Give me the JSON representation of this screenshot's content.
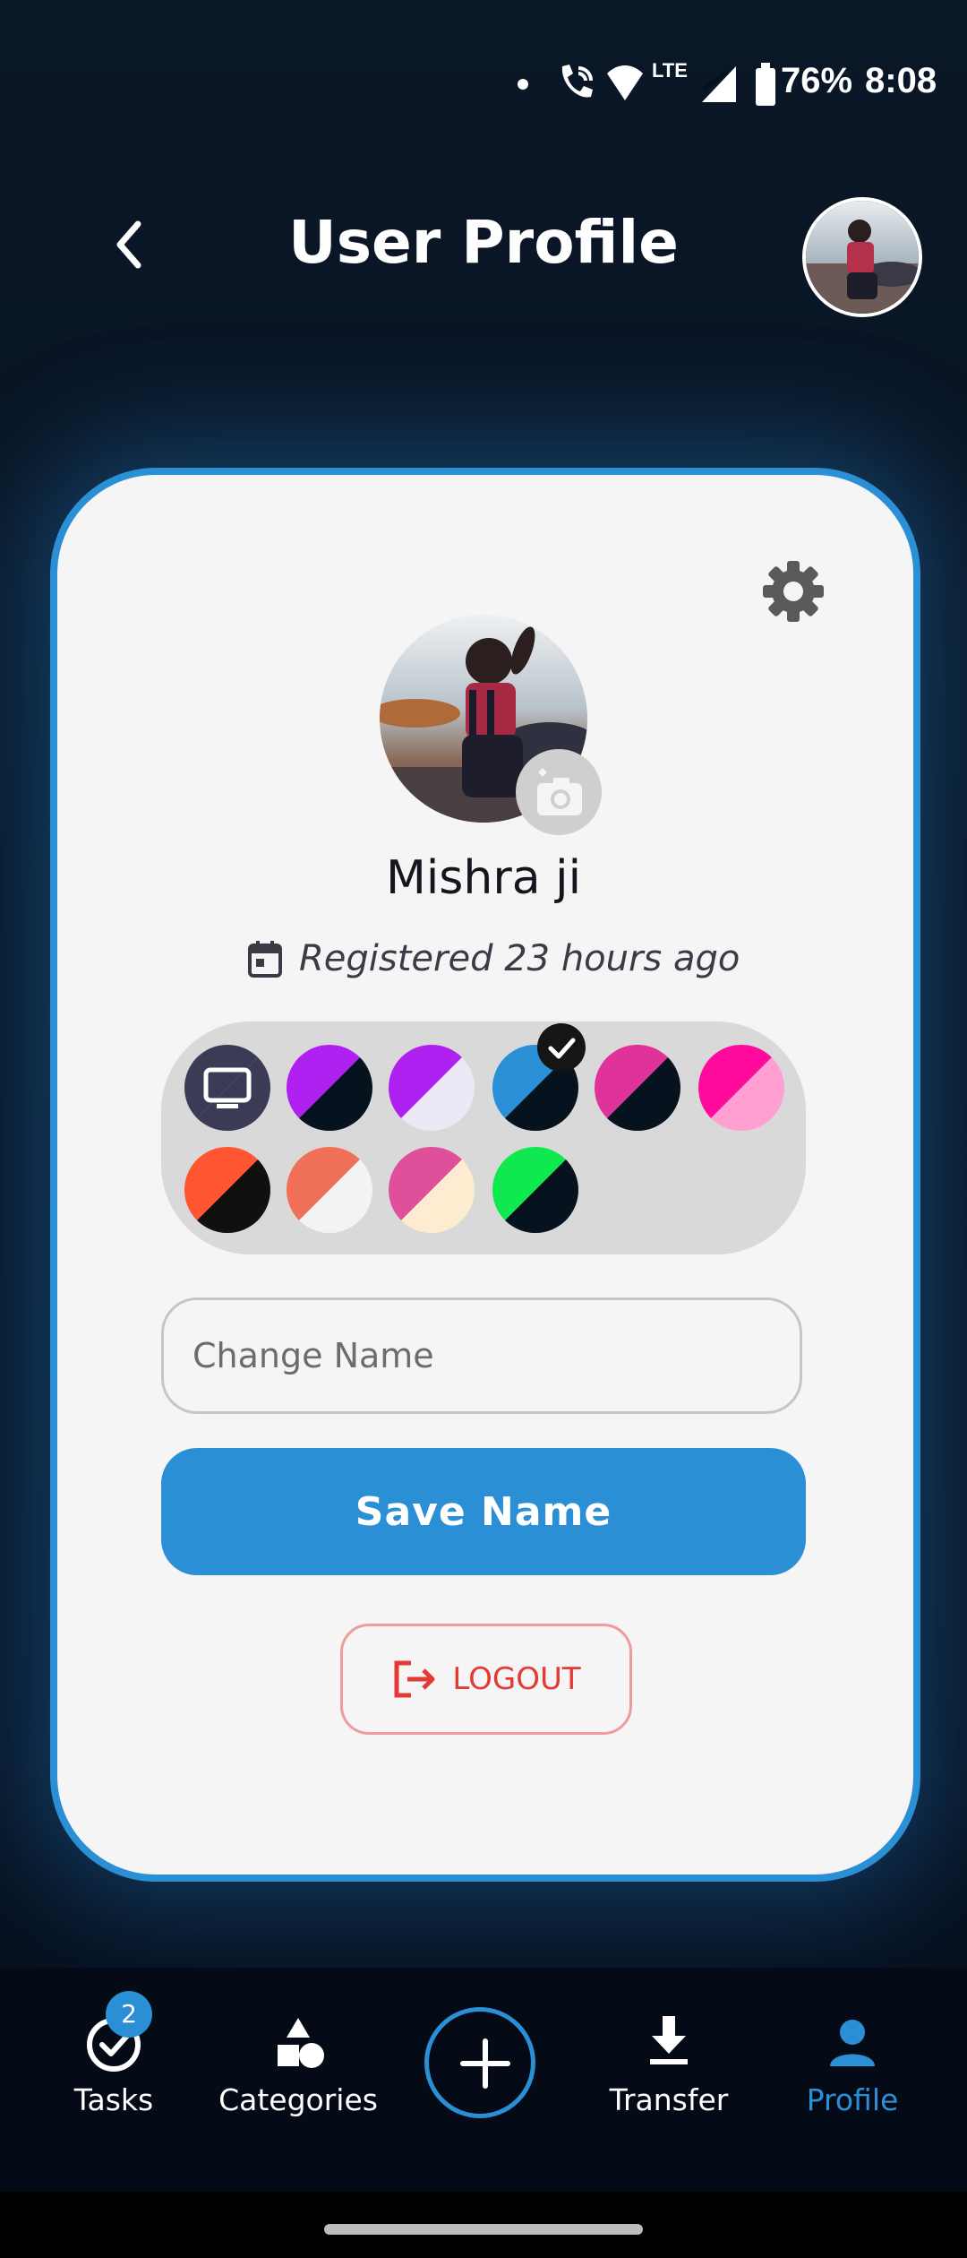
{
  "status_bar": {
    "battery": "76%",
    "time": "8:08",
    "network": "LTE",
    "icons": [
      "dot-icon",
      "wifi-call-icon",
      "wifi-icon",
      "signal-icon",
      "battery-icon"
    ]
  },
  "header": {
    "title": "User Profile",
    "back_icon": "chevron-left-icon",
    "avatar": "user-avatar"
  },
  "profile": {
    "name": "Mishra ji",
    "registered": "Registered 23 hours ago",
    "settings_icon": "gear-icon",
    "camera_icon": "add-photo-icon"
  },
  "themes": {
    "selected_index": 3,
    "swatches": [
      {
        "name": "system",
        "a": "#3b3b55",
        "b": "#3b3b55",
        "icon": "monitor-icon"
      },
      {
        "name": "purple-dark",
        "a": "#b020f0",
        "b": "#06121e"
      },
      {
        "name": "purple-light",
        "a": "#b020f0",
        "b": "#ece8f5"
      },
      {
        "name": "blue-dark",
        "a": "#2b8fd6",
        "b": "#06121e"
      },
      {
        "name": "pink-dark",
        "a": "#e0339a",
        "b": "#06121e"
      },
      {
        "name": "magenta-light",
        "a": "#ff0a9c",
        "b": "#ff9fd2"
      },
      {
        "name": "orange-dark",
        "a": "#ff5530",
        "b": "#101010"
      },
      {
        "name": "coral-light",
        "a": "#f07058",
        "b": "#f3f3f3"
      },
      {
        "name": "rose-cream",
        "a": "#e0509a",
        "b": "#fdecd0"
      },
      {
        "name": "green-dark",
        "a": "#10e850",
        "b": "#06121e"
      }
    ]
  },
  "form": {
    "name_placeholder": "Change Name",
    "name_value": "",
    "save_label": "Save Name",
    "logout_label": "LOGOUT"
  },
  "nav": {
    "tasks_label": "Tasks",
    "tasks_badge": "2",
    "categories_label": "Categories",
    "transfer_label": "Transfer",
    "profile_label": "Profile",
    "active": "Profile"
  },
  "colors": {
    "accent": "#2b8fd6",
    "background": "#06101d",
    "card": "#f5f5f5",
    "danger": "#e53935"
  }
}
